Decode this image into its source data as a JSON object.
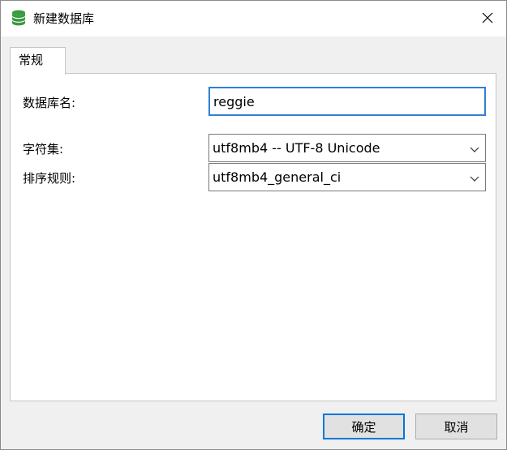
{
  "window": {
    "title": "新建数据库",
    "icon": "database-icon",
    "close_icon": "close-icon"
  },
  "tabs": [
    {
      "label": "常规",
      "active": true
    }
  ],
  "form": {
    "db_name_label": "数据库名:",
    "db_name_value": "reggie",
    "charset_label": "字符集:",
    "charset_value": "utf8mb4 -- UTF-8 Unicode",
    "collation_label": "排序规则:",
    "collation_value": "utf8mb4_general_ci"
  },
  "buttons": {
    "ok_label": "确定",
    "cancel_label": "取消"
  },
  "colors": {
    "accent": "#0078d7",
    "db_icon": "#3a9a3f"
  }
}
